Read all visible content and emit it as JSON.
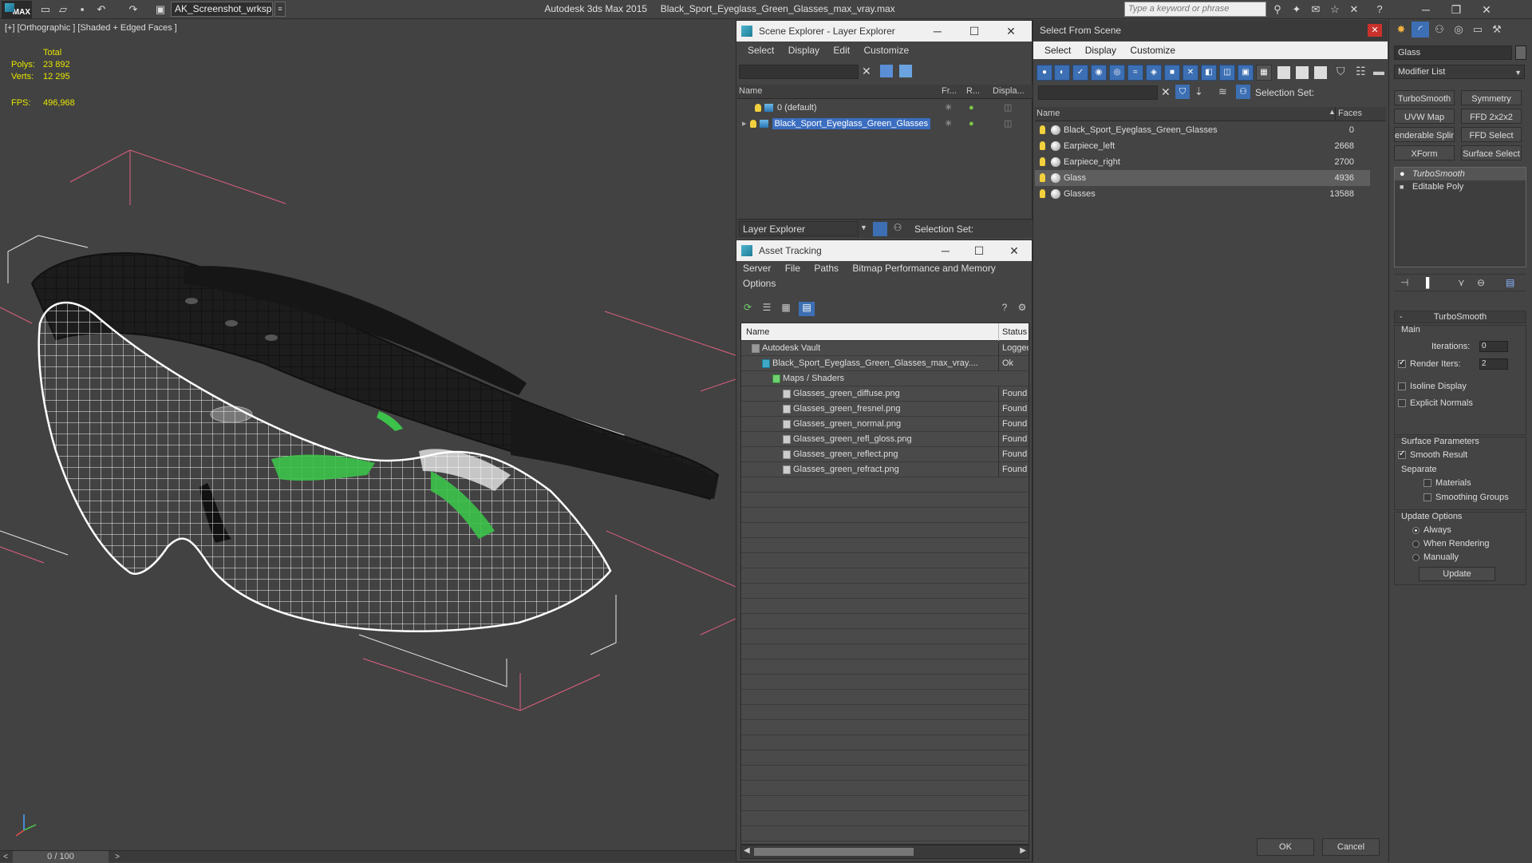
{
  "app": {
    "title": "Autodesk 3ds Max  2015",
    "file": "Black_Sport_Eyeglass_Green_Glasses_max_vray.max",
    "workspace": "AK_Screenshot_wrksp",
    "logo_text": "MAX",
    "search_placeholder": "Type a keyword or phrase"
  },
  "viewport": {
    "label": "[+] [Orthographic ] [Shaded + Edged Faces ]",
    "stats_header": "Total",
    "polys_label": "Polys:",
    "polys_value": "23 892",
    "verts_label": "Verts:",
    "verts_value": "12 295",
    "fps_label": "FPS:",
    "fps_value": "496,968"
  },
  "timeline": {
    "frame": "0 / 100",
    "left": "<",
    "right": ">"
  },
  "scene_explorer": {
    "title": "Scene Explorer - Layer Explorer",
    "menu": [
      "Select",
      "Display",
      "Edit",
      "Customize"
    ],
    "columns": [
      "Name",
      "Fr...",
      "R...",
      "Displa..."
    ],
    "rows": [
      {
        "name": "0 (default)",
        "selected": false
      },
      {
        "name": "Black_Sport_Eyeglass_Green_Glasses",
        "selected": true
      }
    ],
    "bottom_dropdown": "Layer Explorer",
    "selection_set": "Selection Set:"
  },
  "asset_tracking": {
    "title": "Asset Tracking",
    "menu": [
      "Server",
      "File",
      "Paths",
      "Bitmap Performance and Memory"
    ],
    "menu2": [
      "Options"
    ],
    "columns": [
      "Name",
      "Status"
    ],
    "rows": [
      {
        "name": "Autodesk Vault",
        "status": "Logged",
        "indent": 1
      },
      {
        "name": "Black_Sport_Eyeglass_Green_Glasses_max_vray....",
        "status": "Ok",
        "indent": 2
      },
      {
        "name": "Maps / Shaders",
        "status": "",
        "indent": 3
      },
      {
        "name": "Glasses_green_diffuse.png",
        "status": "Found",
        "indent": 4
      },
      {
        "name": "Glasses_green_fresnel.png",
        "status": "Found",
        "indent": 4
      },
      {
        "name": "Glasses_green_normal.png",
        "status": "Found",
        "indent": 4
      },
      {
        "name": "Glasses_green_refl_gloss.png",
        "status": "Found",
        "indent": 4
      },
      {
        "name": "Glasses_green_reflect.png",
        "status": "Found",
        "indent": 4
      },
      {
        "name": "Glasses_green_refract.png",
        "status": "Found",
        "indent": 4
      }
    ]
  },
  "select_from_scene": {
    "title": "Select From Scene",
    "menu": [
      "Select",
      "Display",
      "Customize"
    ],
    "selection_set": "Selection Set:",
    "columns": [
      "Name",
      "Faces"
    ],
    "rows": [
      {
        "name": "Black_Sport_Eyeglass_Green_Glasses",
        "faces": "0",
        "selected": false
      },
      {
        "name": "Earpiece_left",
        "faces": "2668",
        "selected": false
      },
      {
        "name": "Earpiece_right",
        "faces": "2700",
        "selected": false
      },
      {
        "name": "Glass",
        "faces": "4936",
        "selected": true
      },
      {
        "name": "Glasses",
        "faces": "13588",
        "selected": false
      }
    ],
    "ok": "OK",
    "cancel": "Cancel"
  },
  "command_panel": {
    "object_name": "Glass",
    "modifier_list": "Modifier List",
    "buttons": [
      "TurboSmooth",
      "Symmetry",
      "UVW Map",
      "FFD 2x2x2",
      "enderable Splin",
      "FFD Select",
      "XForm",
      "Surface Select"
    ],
    "stack": [
      "TurboSmooth",
      "Editable Poly"
    ],
    "rollout_title": "TurboSmooth",
    "main": "Main",
    "iterations_label": "Iterations:",
    "iterations_value": "0",
    "render_iters_label": "Render Iters:",
    "render_iters_value": "2",
    "isoline": "Isoline Display",
    "explicit_normals": "Explicit Normals",
    "surface_params": "Surface Parameters",
    "smooth_result": "Smooth Result",
    "separate": "Separate",
    "materials": "Materials",
    "smoothing_groups": "Smoothing Groups",
    "update_options": "Update Options",
    "always": "Always",
    "when_rendering": "When Rendering",
    "manually": "Manually",
    "update": "Update"
  }
}
